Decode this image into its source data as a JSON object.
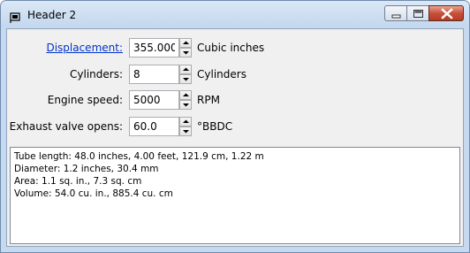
{
  "window": {
    "title": "Header 2"
  },
  "form": {
    "rows": [
      {
        "label": "Displacement:",
        "value": "355.000",
        "unit": "Cubic inches"
      },
      {
        "label": "Cylinders:",
        "value": "8",
        "unit": "Cylinders"
      },
      {
        "label": "Engine speed:",
        "value": "5000",
        "unit": "RPM"
      },
      {
        "label": "Exhaust valve opens:",
        "value": "60.0",
        "unit": "°BBDC"
      }
    ]
  },
  "output": {
    "lines": [
      "Tube length: 48.0 inches, 4.00 feet, 121.9 cm, 1.22 m",
      "Diameter: 1.2 inches, 30.4 mm",
      "Area: 1.1 sq. in., 7.3 sq. cm",
      "Volume: 54.0 cu. in., 885.4 cu. cm"
    ]
  },
  "icons": {
    "app": "flag-icon",
    "minimize": "minimize-icon",
    "maximize": "maximize-icon",
    "close": "close-icon",
    "spin_up": "arrow-up-icon",
    "spin_down": "arrow-down-icon"
  },
  "colors": {
    "link": "#0033cc",
    "titlebar": "#c4d7ee",
    "close_button": "#c7503a"
  }
}
